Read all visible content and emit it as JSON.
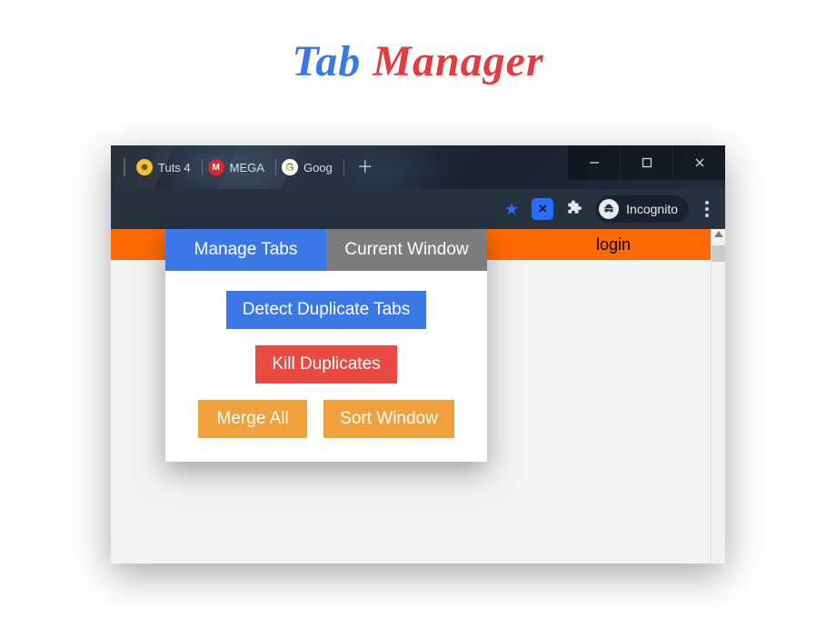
{
  "title": {
    "word1": "Tab",
    "word2": "Manager"
  },
  "browser": {
    "tabs": [
      {
        "label": "Tuts 4",
        "icon": "smiley"
      },
      {
        "label": "MEGA",
        "icon": "mega"
      },
      {
        "label": "Goog",
        "icon": "google"
      }
    ],
    "incognito_label": "Incognito"
  },
  "page": {
    "login_label": "login"
  },
  "popup": {
    "tabs": {
      "manage": "Manage Tabs",
      "current": "Current Window"
    },
    "buttons": {
      "detect": "Detect Duplicate Tabs",
      "kill": "Kill Duplicates",
      "merge": "Merge All",
      "sort": "Sort Window"
    }
  }
}
